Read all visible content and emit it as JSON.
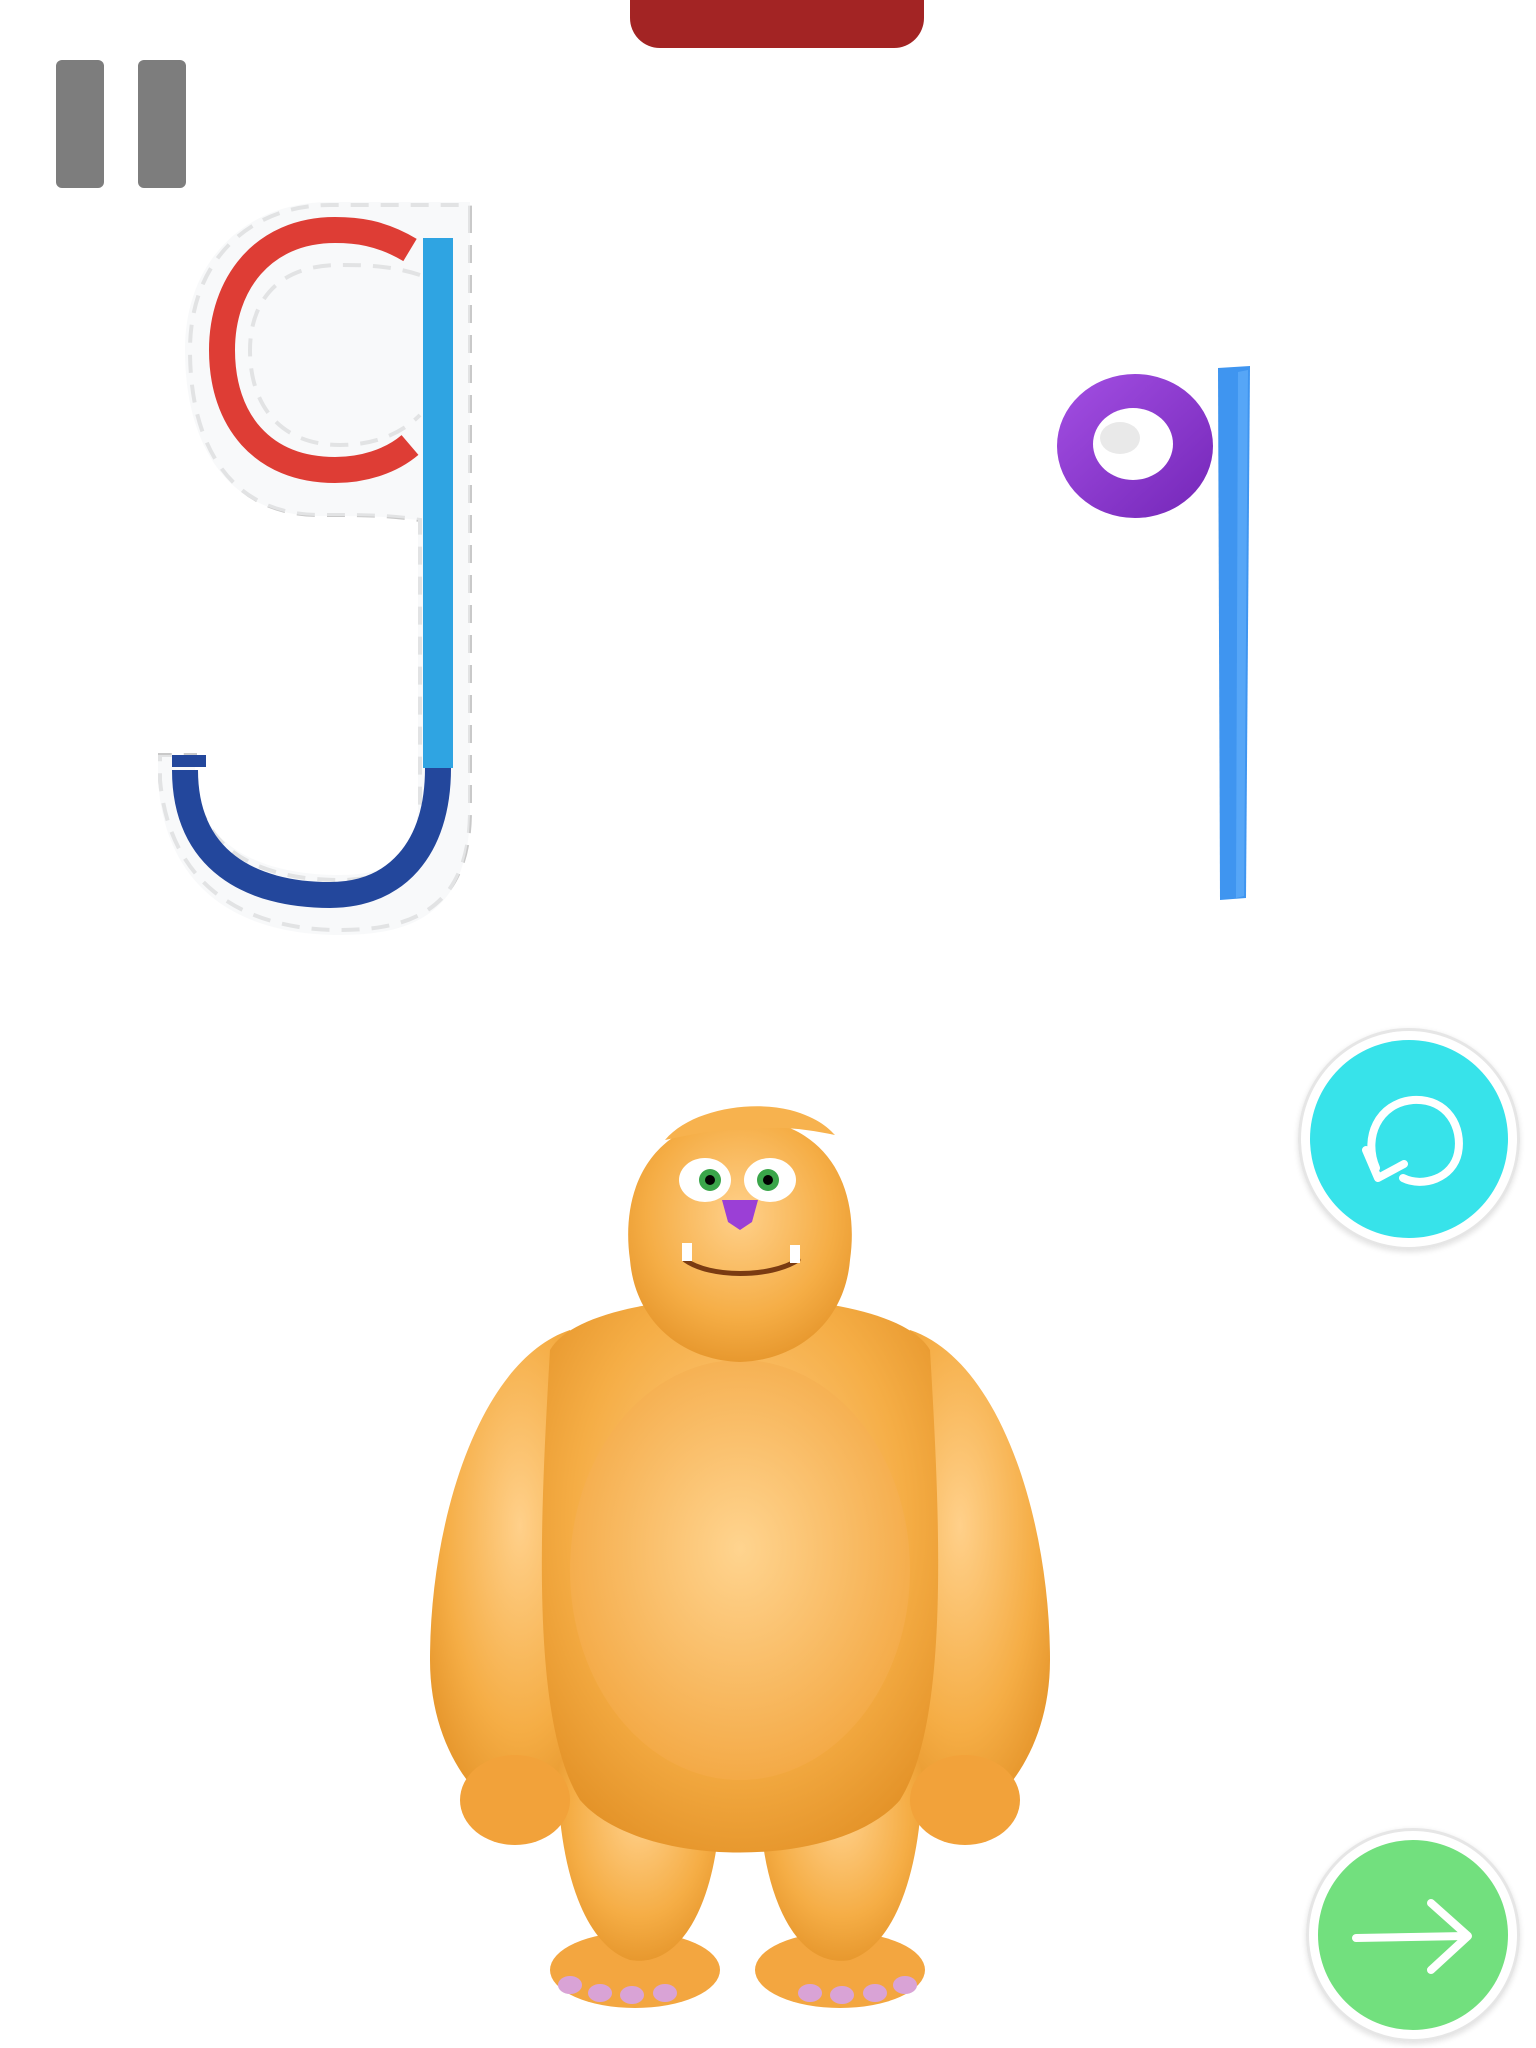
{
  "app": {
    "screen": "letter-tracing",
    "traced_letter": "g",
    "drawn_letter": "q"
  },
  "colors": {
    "top_tab": "#a32424",
    "pause": "#7d7d7d",
    "stroke_1": "#de3d35",
    "stroke_2": "#2fa4e2",
    "stroke_3": "#23479c",
    "drawn_loop": "#8c35d2",
    "drawn_stem": "#3f95f0",
    "replay": "#37e3ea",
    "next": "#72e07e",
    "monster_fur": "#f5ad45"
  },
  "controls": {
    "pause_icon": "pause-icon",
    "replay_icon": "replay-icon",
    "next_icon": "arrow-right-icon"
  }
}
